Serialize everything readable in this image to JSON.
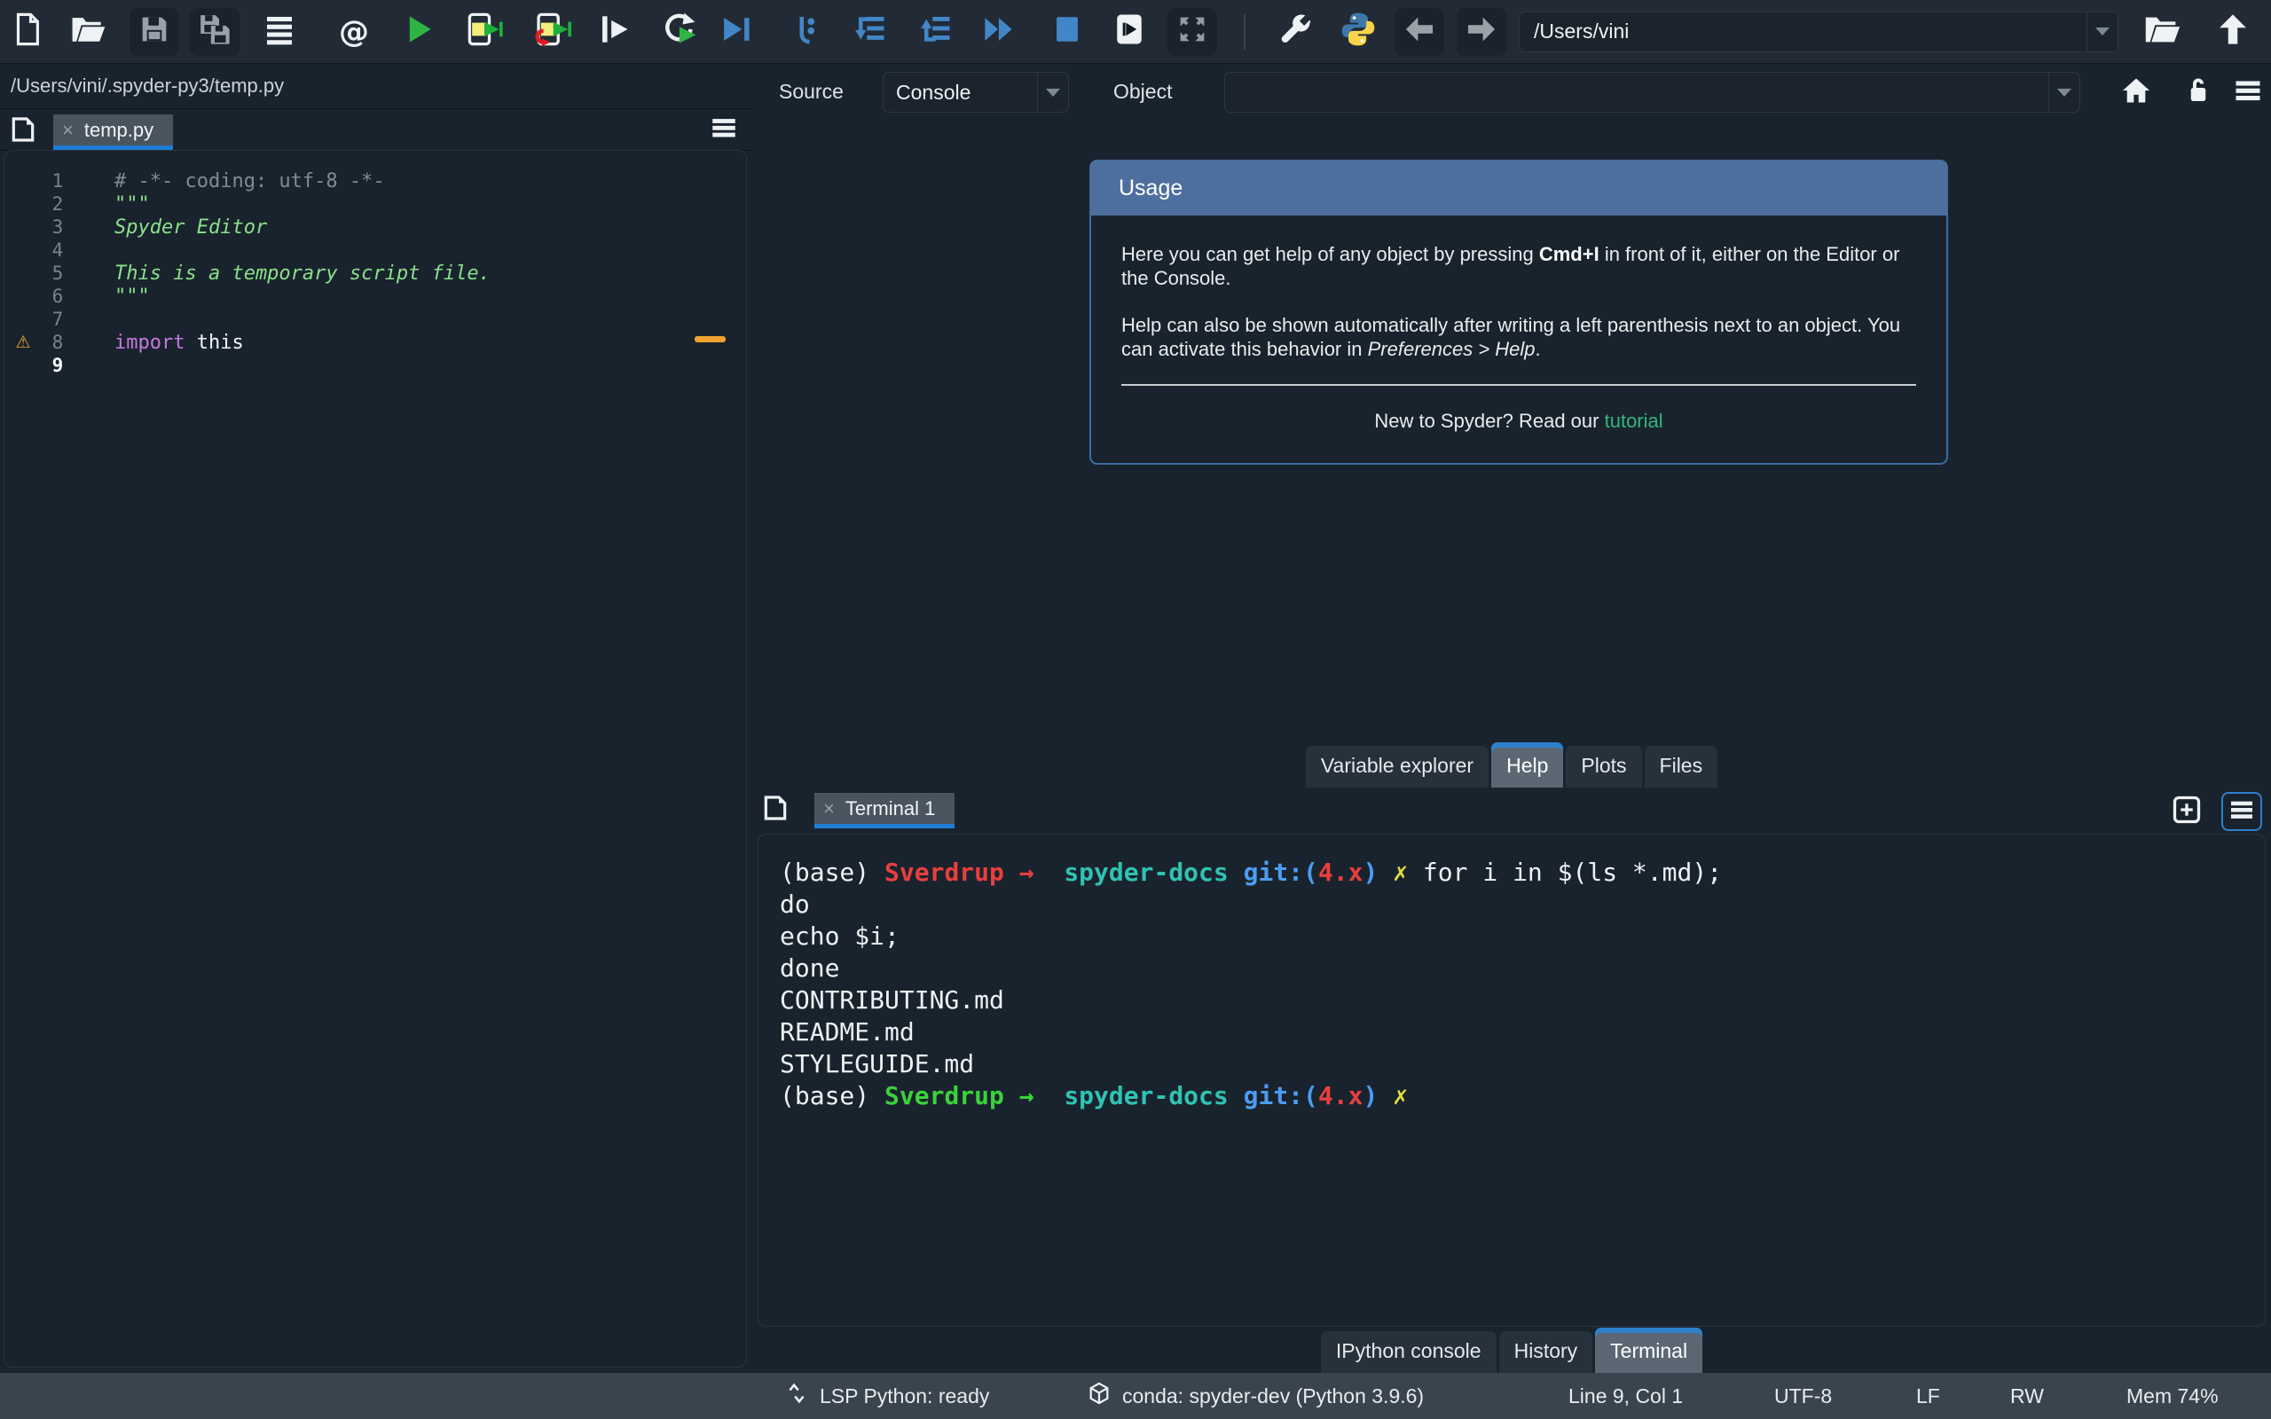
{
  "toolbar": {
    "path_value": "/Users/vini",
    "icon_names": [
      "new-file",
      "open-file",
      "save",
      "save-all",
      "file-switcher",
      "find-symbols",
      "run-file",
      "run-cell",
      "run-cell-advance",
      "run-selection",
      "rerun-cell",
      "debug-file",
      "debug-step",
      "debug-step-into",
      "debug-step-out",
      "debug-continue",
      "debug-stop",
      "split-panel",
      "maximize-pane",
      "preferences-wrench",
      "python-interpreter",
      "back",
      "forward",
      "open-directory",
      "parent-directory"
    ]
  },
  "editor": {
    "breadcrumb": "/Users/vini/.spyder-py3/temp.py",
    "tab_label": "temp.py",
    "close_glyph": "×",
    "warning_glyph": "⚠",
    "lines": [
      {
        "num": "1",
        "segments": [
          {
            "t": "# -*- coding: utf-8 -*-",
            "c": "comment"
          }
        ]
      },
      {
        "num": "2",
        "segments": [
          {
            "t": "\"\"\"",
            "c": "string"
          }
        ]
      },
      {
        "num": "3",
        "segments": [
          {
            "t": "Spyder Editor",
            "c": "stringi"
          }
        ]
      },
      {
        "num": "4",
        "segments": []
      },
      {
        "num": "5",
        "segments": [
          {
            "t": "This is a temporary script file.",
            "c": "stringi"
          }
        ]
      },
      {
        "num": "6",
        "segments": [
          {
            "t": "\"\"\"",
            "c": "string"
          }
        ]
      },
      {
        "num": "7",
        "segments": []
      },
      {
        "num": "8",
        "warning": true,
        "segments": [
          {
            "t": "import",
            "c": "keyword"
          },
          {
            "t": " this",
            "c": "plain"
          }
        ]
      },
      {
        "num": "9",
        "current": true,
        "segments": []
      }
    ]
  },
  "help": {
    "source_label": "Source",
    "source_value": "Console",
    "object_label": "Object",
    "object_value": "",
    "icon_names": [
      "home",
      "unlock",
      "options-menu"
    ],
    "usage": {
      "title": "Usage",
      "p1_pre": "Here you can get help of any object by pressing ",
      "p1_bold": "Cmd+I",
      "p1_post": " in front of it, either on the Editor or the Console.",
      "p2_pre": "Help can also be shown automatically after writing a left parenthesis next to an object. You can activate this behavior in ",
      "p2_italic": "Preferences > Help",
      "p2_post": ".",
      "footer_pre": "New to Spyder? Read our ",
      "footer_link": "tutorial"
    },
    "tabs": [
      {
        "label": "Variable explorer",
        "active": false
      },
      {
        "label": "Help",
        "active": true
      },
      {
        "label": "Plots",
        "active": false
      },
      {
        "label": "Files",
        "active": false
      }
    ]
  },
  "terminal": {
    "tab_label": "Terminal 1",
    "close_glyph": "×",
    "lines": [
      {
        "segments": [
          {
            "t": "(base) ",
            "c": "w"
          },
          {
            "t": "Sverdrup",
            "c": "red b"
          },
          {
            "t": " → ",
            "c": "red b"
          },
          {
            "t": " ",
            "c": "w"
          },
          {
            "t": "spyder-docs",
            "c": "teal b"
          },
          {
            "t": " ",
            "c": "w"
          },
          {
            "t": "git:(",
            "c": "blue b"
          },
          {
            "t": "4.x",
            "c": "red b"
          },
          {
            "t": ")",
            "c": "blue b"
          },
          {
            "t": " ",
            "c": "w"
          },
          {
            "t": "✗",
            "c": "yellow"
          },
          {
            "t": " for i in $(ls *.md);",
            "c": "w"
          }
        ]
      },
      {
        "segments": [
          {
            "t": "do",
            "c": "w"
          }
        ]
      },
      {
        "segments": [
          {
            "t": "echo $i;",
            "c": "w"
          }
        ]
      },
      {
        "segments": [
          {
            "t": "done",
            "c": "w"
          }
        ]
      },
      {
        "segments": [
          {
            "t": "CONTRIBUTING.md",
            "c": "w"
          }
        ]
      },
      {
        "segments": [
          {
            "t": "README.md",
            "c": "w"
          }
        ]
      },
      {
        "segments": [
          {
            "t": "STYLEGUIDE.md",
            "c": "w"
          }
        ]
      },
      {
        "segments": [
          {
            "t": "(base) ",
            "c": "w"
          },
          {
            "t": "Sverdrup",
            "c": "green b"
          },
          {
            "t": " → ",
            "c": "green b"
          },
          {
            "t": " ",
            "c": "w"
          },
          {
            "t": "spyder-docs",
            "c": "teal b"
          },
          {
            "t": " ",
            "c": "w"
          },
          {
            "t": "git:(",
            "c": "blue b"
          },
          {
            "t": "4.x",
            "c": "red b"
          },
          {
            "t": ")",
            "c": "blue b"
          },
          {
            "t": " ",
            "c": "w"
          },
          {
            "t": "✗",
            "c": "yellow"
          }
        ]
      }
    ],
    "tabs": [
      {
        "label": "IPython console",
        "active": false
      },
      {
        "label": "History",
        "active": false
      },
      {
        "label": "Terminal",
        "active": true
      }
    ]
  },
  "statusbar": {
    "lsp": "LSP Python: ready",
    "conda": "conda: spyder-dev (Python 3.9.6)",
    "cursor": "Line 9, Col 1",
    "encoding": "UTF-8",
    "eol": "LF",
    "permissions": "RW",
    "memory": "Mem 74%",
    "icon_names": [
      "lsp-arrows",
      "conda-cube"
    ]
  },
  "colors": {
    "accent_blue": "#2e80cb",
    "usage_header_blue": "#4d6f9e",
    "link_green": "#30b97c",
    "warning_orange": "#f0a32f",
    "keyword_magenta": "#c678dd",
    "string_green": "#8be08b",
    "comment_gray": "#7f8b96",
    "term_red": "#e93f3f",
    "term_green": "#3bd23b",
    "term_teal": "#2fc3b2",
    "term_blue": "#4a9df2",
    "term_yellow": "#dfdf3f",
    "statusbar_bg": "#3a444e",
    "toolbar_bg": "#222b35",
    "pane_bg": "#19232d"
  }
}
